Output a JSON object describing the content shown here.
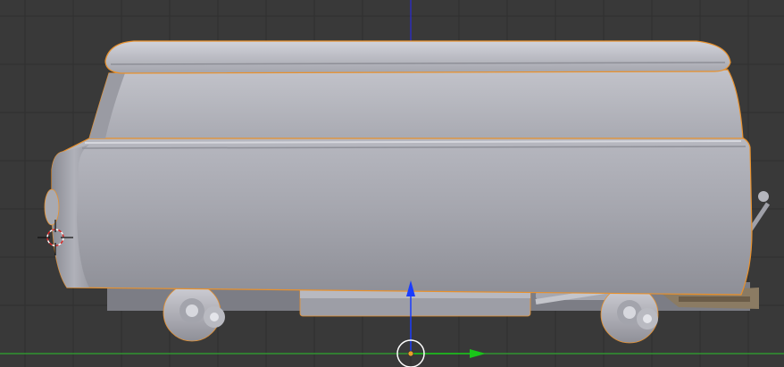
{
  "viewport": {
    "background_color": "#393939",
    "grid_color": "#2f2f2f",
    "x_axis_color": "#2fa82f",
    "z_axis_line_color": "#2a2ad8",
    "selection_outline_color": "#e8912d"
  },
  "object": {
    "kind": "van-body-mesh",
    "selected": true,
    "shading": "solid-grey"
  },
  "gizmo": {
    "z_arrow_color": "#1a3cff",
    "y_arrow_color": "#19c619",
    "origin_color": "#e8a02a"
  },
  "cursor_3d": {
    "icon": "3d-cursor-icon"
  }
}
